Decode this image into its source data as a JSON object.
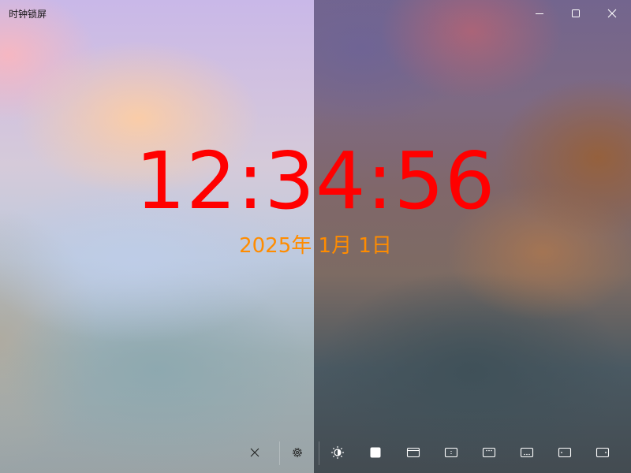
{
  "window": {
    "title": "时钟锁屏",
    "controls": [
      "minimize-icon",
      "maximize-icon",
      "close-icon"
    ]
  },
  "clock": {
    "time": "12:34:56",
    "date": "2025年 1月 1日",
    "time_color": "#ff0000",
    "date_color": "#ff8c00"
  },
  "toolbar": {
    "buttons": [
      {
        "name": "close-clock-button",
        "icon": "x-icon"
      },
      {
        "name": "settings-button",
        "icon": "gear-icon"
      },
      {
        "name": "brightness-button",
        "icon": "brightness-icon"
      },
      {
        "name": "background-button",
        "icon": "filled-square-icon"
      },
      {
        "name": "layout-top-bar-button",
        "icon": "window-top-bar-icon"
      },
      {
        "name": "layout-center-button",
        "icon": "center-dots-icon"
      },
      {
        "name": "layout-top-dots-button",
        "icon": "top-dots-icon"
      },
      {
        "name": "layout-bottom-dots-button",
        "icon": "bottom-dots-icon"
      },
      {
        "name": "layout-left-button",
        "icon": "left-panel-icon"
      },
      {
        "name": "layout-right-button",
        "icon": "right-panel-icon"
      }
    ]
  }
}
